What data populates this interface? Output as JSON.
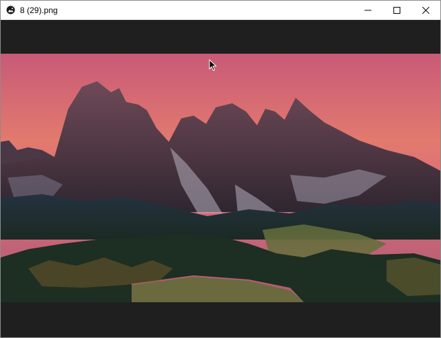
{
  "window": {
    "title": "8 (29).png",
    "app_icon": "photos-app-icon",
    "controls": [
      "minimize-icon",
      "maximize-icon",
      "close-icon"
    ]
  },
  "viewer": {
    "background": "#1f1f1f",
    "image": {
      "subject": "mountain-landscape-photo",
      "colors": {
        "sky": "#d86a7a",
        "mountains": "#5a3f4c",
        "forest": "#1d2e22"
      }
    }
  }
}
